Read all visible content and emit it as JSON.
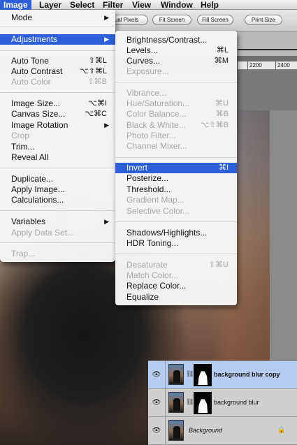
{
  "menubar": {
    "items": [
      "Image",
      "Layer",
      "Select",
      "Filter",
      "View",
      "Window",
      "Help"
    ]
  },
  "options_bar": {
    "buttons": [
      "ual Pixels",
      "Fit Screen",
      "Fill Screen",
      "Print Size"
    ]
  },
  "ruler": {
    "labels": [
      "2200",
      "2400"
    ]
  },
  "image_menu": {
    "items": [
      {
        "label": "Mode",
        "submenu": true
      },
      {
        "label": "Adjustments",
        "submenu": true,
        "highlighted": true
      },
      {
        "label": "Auto Tone",
        "shortcut": "⇧⌘L"
      },
      {
        "label": "Auto Contrast",
        "shortcut": "⌥⇧⌘L"
      },
      {
        "label": "Auto Color",
        "shortcut": "⇧⌘B",
        "disabled": true
      },
      {
        "label": "Image Size...",
        "shortcut": "⌥⌘I"
      },
      {
        "label": "Canvas Size...",
        "shortcut": "⌥⌘C"
      },
      {
        "label": "Image Rotation",
        "submenu": true
      },
      {
        "label": "Crop",
        "disabled": true
      },
      {
        "label": "Trim..."
      },
      {
        "label": "Reveal All"
      },
      {
        "label": "Duplicate..."
      },
      {
        "label": "Apply Image..."
      },
      {
        "label": "Calculations..."
      },
      {
        "label": "Variables",
        "submenu": true
      },
      {
        "label": "Apply Data Set...",
        "disabled": true
      },
      {
        "label": "Trap...",
        "disabled": true
      }
    ]
  },
  "adjustments_menu": {
    "items": [
      {
        "label": "Brightness/Contrast..."
      },
      {
        "label": "Levels...",
        "shortcut": "⌘L"
      },
      {
        "label": "Curves...",
        "shortcut": "⌘M"
      },
      {
        "label": "Exposure...",
        "disabled": true
      },
      {
        "label": "Vibrance...",
        "disabled": true
      },
      {
        "label": "Hue/Saturation...",
        "shortcut": "⌘U",
        "disabled": true
      },
      {
        "label": "Color Balance...",
        "shortcut": "⌘B",
        "disabled": true
      },
      {
        "label": "Black & White...",
        "shortcut": "⌥⇧⌘B",
        "disabled": true
      },
      {
        "label": "Photo Filter...",
        "disabled": true
      },
      {
        "label": "Channel Mixer...",
        "disabled": true
      },
      {
        "label": "Invert",
        "shortcut": "⌘I",
        "highlighted": true
      },
      {
        "label": "Posterize..."
      },
      {
        "label": "Threshold..."
      },
      {
        "label": "Gradient Map...",
        "disabled": true
      },
      {
        "label": "Selective Color...",
        "disabled": true
      },
      {
        "label": "Shadows/Highlights..."
      },
      {
        "label": "HDR Toning..."
      },
      {
        "label": "Desaturate",
        "shortcut": "⇧⌘U",
        "disabled": true
      },
      {
        "label": "Match Color...",
        "disabled": true
      },
      {
        "label": "Replace Color..."
      },
      {
        "label": "Equalize"
      }
    ]
  },
  "layers": [
    {
      "name": "background blur copy",
      "selected": true
    },
    {
      "name": "background blur"
    },
    {
      "name": "Background",
      "locked": true
    }
  ]
}
